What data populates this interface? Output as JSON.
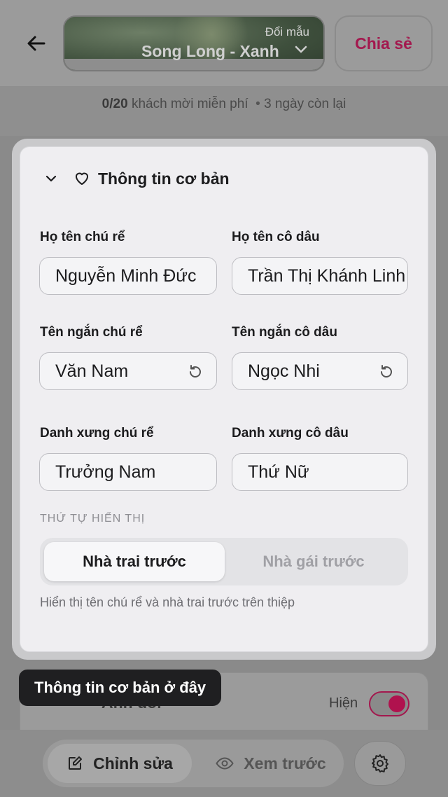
{
  "header": {
    "template_small_label": "Đổi mẫu",
    "template_name": "Song Long - Xanh",
    "share_label": "Chia sẻ"
  },
  "guest_info": {
    "count": "0/20",
    "text": "khách mời miễn phí",
    "separator": "•",
    "remaining": "3 ngày còn lại"
  },
  "section": {
    "title": "Thông tin cơ bản",
    "fields": {
      "groom_full_label": "Họ tên chú rể",
      "groom_full_value": "Nguyễn Minh Đức",
      "bride_full_label": "Họ tên cô dâu",
      "bride_full_value": "Trần Thị Khánh Linh",
      "groom_short_label": "Tên ngắn chú rể",
      "groom_short_value": "Văn Nam",
      "bride_short_label": "Tên ngắn cô dâu",
      "bride_short_value": "Ngọc Nhi",
      "groom_title_label": "Danh xưng chú rể",
      "groom_title_value": "Trưởng Nam",
      "bride_title_label": "Danh xưng cô dâu",
      "bride_title_value": "Thứ Nữ"
    },
    "order_label": "THỨ TỰ HIỂN THỊ",
    "order_options": [
      "Nhà trai trước",
      "Nhà gái trước"
    ],
    "hint": "Hiển thị tên chú rể và nhà trai trước trên thiệp"
  },
  "next_section": {
    "title": "Ảnh đôi",
    "show_label": "Hiện"
  },
  "tooltip": "Thông tin cơ bản ở đây",
  "bottom_nav": {
    "edit_label": "Chỉnh sửa",
    "preview_label": "Xem trước"
  },
  "colors": {
    "accent": "#a3184e",
    "card": "#efeef1"
  }
}
